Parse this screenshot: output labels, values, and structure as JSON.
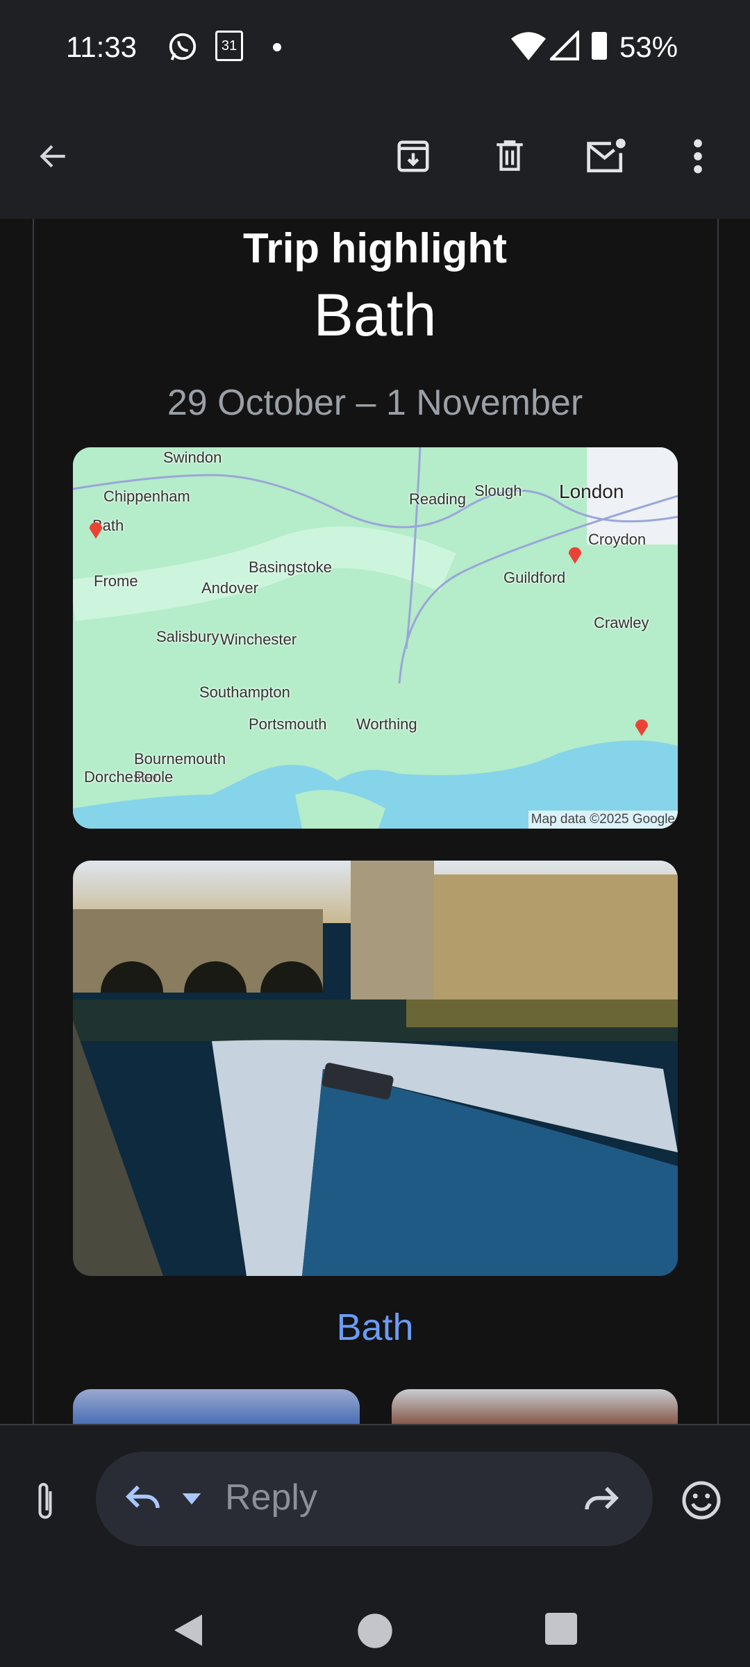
{
  "status_bar": {
    "time": "11:33",
    "battery": "53%",
    "icons": [
      "whatsapp-icon",
      "calendar-icon",
      "dot-icon",
      "wifi-icon",
      "signal-icon",
      "battery-icon"
    ],
    "calendar_day": "31"
  },
  "toolbar": {
    "icons": [
      "back-arrow-icon",
      "archive-icon",
      "delete-icon",
      "mark-unread-icon",
      "more-vert-icon"
    ]
  },
  "email": {
    "heading": "Trip highlight",
    "place": "Bath",
    "dates": "29 October – 1 November",
    "map": {
      "labels": [
        "Swindon",
        "Chippenham",
        "Bath",
        "Reading",
        "Slough",
        "London",
        "Croydon",
        "Frome",
        "Andover",
        "Basingstoke",
        "Guildford",
        "Crawley",
        "Salisbury",
        "Winchester",
        "Southampton",
        "Portsmouth",
        "Worthing",
        "Bournemouth",
        "Dorchester",
        "Poole"
      ],
      "attribution": "Map data ©2025 Google",
      "pin_color": "#ea4335"
    },
    "photo_link": "Bath"
  },
  "reply_bar": {
    "placeholder": "Reply"
  },
  "colors": {
    "link": "#6b9cf6",
    "background": "#131314",
    "toolbar": "#1f2024"
  }
}
